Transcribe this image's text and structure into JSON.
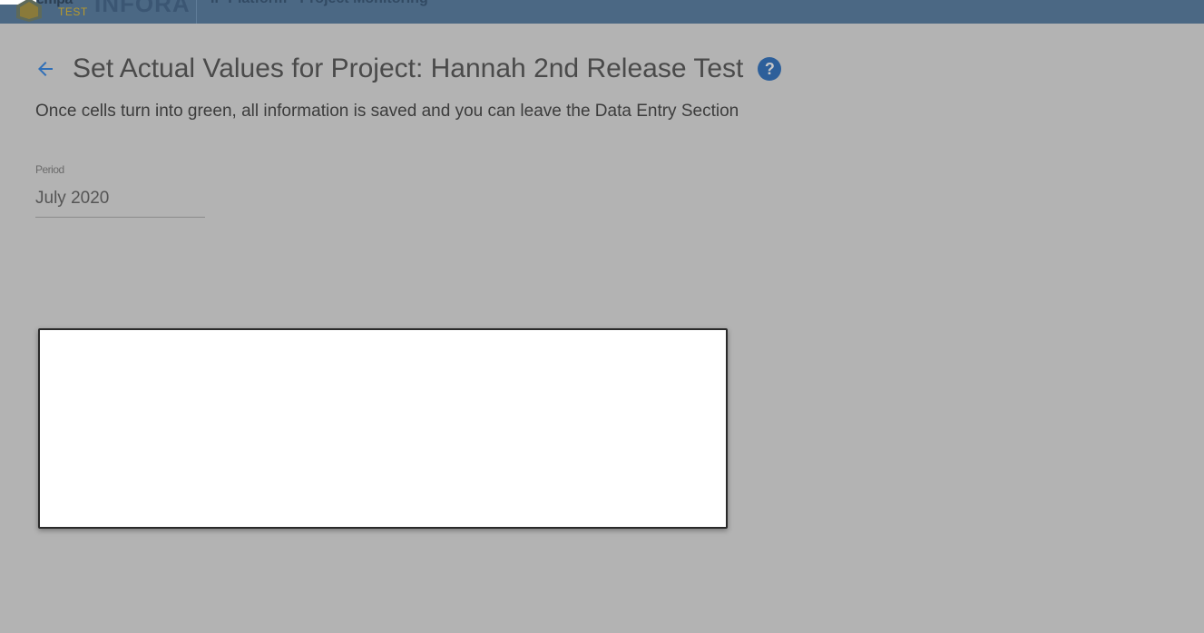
{
  "appbar": {
    "logo_text": "empa",
    "logo_big": "INFORA",
    "logo_sub": "TEST",
    "title": "IP Platform - Project Monitoring",
    "color": "#4b6884"
  },
  "header": {
    "back_icon": "arrow-left-icon",
    "title": "Set Actual Values for Project: Hannah 2nd Release Test",
    "help_icon": "help-circle-icon",
    "help_glyph": "?"
  },
  "subtitle": "Once cells turn into green, all information is saved and you can leave the Data Entry Section",
  "period": {
    "label": "Period",
    "value": "July 2020"
  },
  "colors": {
    "overlay_background": "#b3b3b3",
    "accent": "#2d5f9a",
    "dialog_background": "#ffffff"
  }
}
